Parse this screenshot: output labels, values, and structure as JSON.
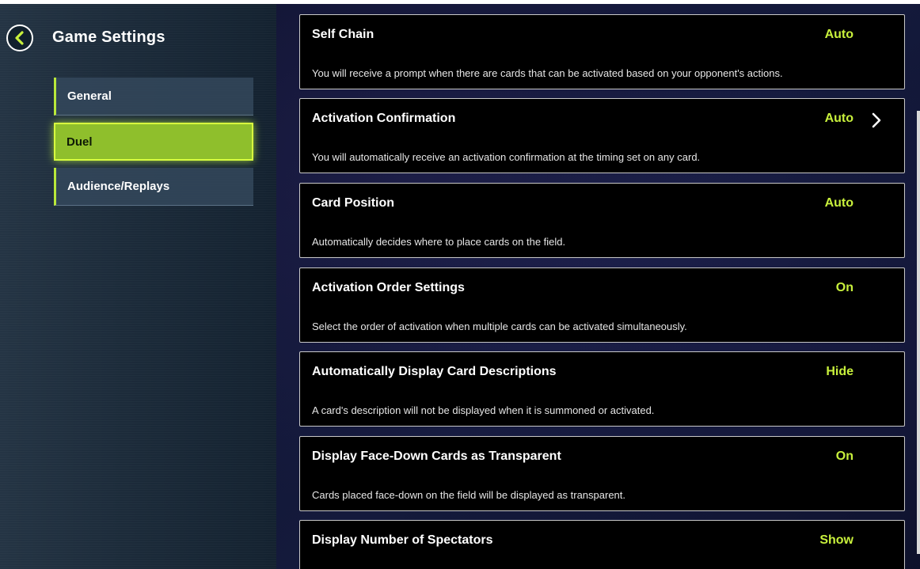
{
  "sidebar": {
    "title": "Game Settings",
    "items": [
      {
        "label": "General"
      },
      {
        "label": "Duel"
      },
      {
        "label": "Audience/Replays"
      }
    ]
  },
  "settings": [
    {
      "name": "Self Chain",
      "value": "Auto",
      "description": "You will receive a prompt when there are cards that can be activated based on your opponent's actions."
    },
    {
      "name": "Activation Confirmation",
      "value": "Auto",
      "description": "You will automatically receive an activation confirmation at the timing set on any card."
    },
    {
      "name": "Card Position",
      "value": "Auto",
      "description": "Automatically decides where to place cards on the field."
    },
    {
      "name": "Activation Order Settings",
      "value": "On",
      "description": "Select the order of activation when multiple cards can be activated simultaneously."
    },
    {
      "name": "Automatically Display Card Descriptions",
      "value": "Hide",
      "description": "A card's description will not be displayed when it is summoned or activated."
    },
    {
      "name": "Display Face-Down Cards as Transparent",
      "value": "On",
      "description": "Cards placed face-down on the field will be displayed as transparent."
    },
    {
      "name": "Display Number of Spectators",
      "value": "Show",
      "description": ""
    }
  ],
  "colors": {
    "accent": "#c8f03c",
    "active_nav": "#8fbf2c",
    "card_bg": "#000000"
  },
  "icons": {
    "back": "back-arrow-icon",
    "chevron": "chevron-right-icon"
  }
}
